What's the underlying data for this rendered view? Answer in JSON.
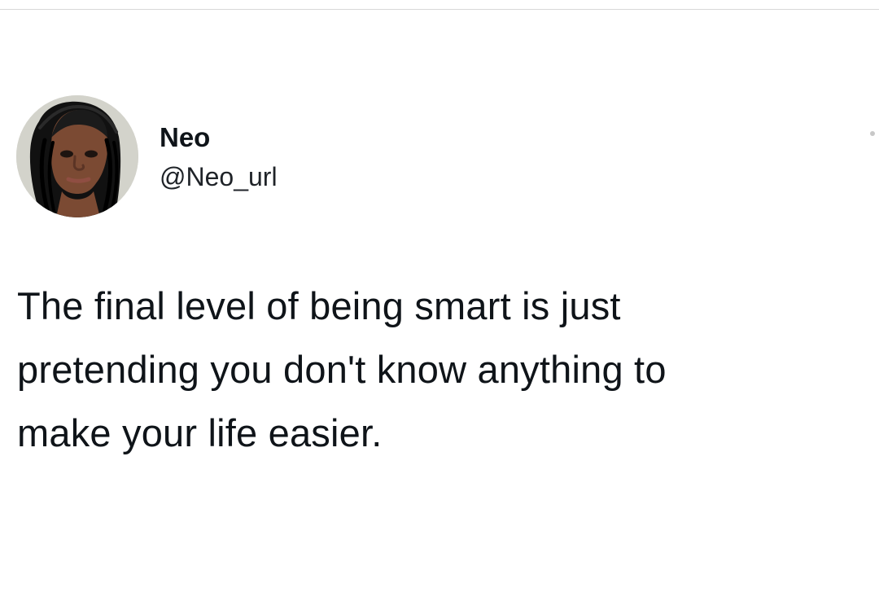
{
  "tweet": {
    "author": {
      "display_name": "Neo",
      "handle": "@Neo_url",
      "avatar_icon": "profile-photo"
    },
    "text_lines": [
      "The final level of being smart is just",
      "pretending you don't know anything to",
      "make your life easier."
    ],
    "menu_icon": "more-options-icon"
  },
  "colors": {
    "background": "#ffffff",
    "text": "#0f1419",
    "divider": "#d8d8d8"
  }
}
